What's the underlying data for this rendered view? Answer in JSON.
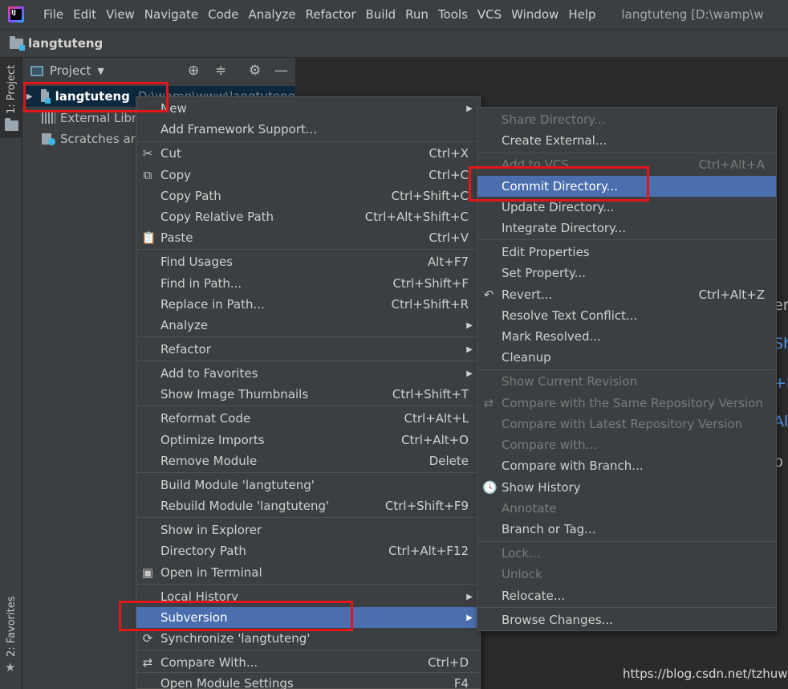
{
  "menubar": {
    "items": [
      "File",
      "Edit",
      "View",
      "Navigate",
      "Code",
      "Analyze",
      "Refactor",
      "Build",
      "Run",
      "Tools",
      "VCS",
      "Window",
      "Help"
    ],
    "window_title": "langtuteng [D:\\wamp\\w"
  },
  "navbar": {
    "project_name": "langtuteng"
  },
  "left_stripe": {
    "project_tab": "1: Project",
    "favorites_tab": "2: Favorites"
  },
  "project_panel": {
    "title": "Project",
    "root": {
      "name": "langtuteng",
      "path": "D:\\wamp\\www\\langtuteng"
    },
    "external_libraries": "External Libra",
    "scratches": "Scratches and"
  },
  "editor_fragments": [
    "ere",
    "Sh",
    "+I",
    "Al",
    "p"
  ],
  "main_menu": {
    "items": [
      {
        "label": "New",
        "submenu": true
      },
      {
        "label": "Add Framework Support..."
      },
      {
        "label": "Cut",
        "shortcut": "Ctrl+X",
        "icon": "✂"
      },
      {
        "label": "Copy",
        "shortcut": "Ctrl+C",
        "icon": "⧉"
      },
      {
        "label": "Copy Path",
        "shortcut": "Ctrl+Shift+C"
      },
      {
        "label": "Copy Relative Path",
        "shortcut": "Ctrl+Alt+Shift+C"
      },
      {
        "label": "Paste",
        "shortcut": "Ctrl+V",
        "icon": "📋"
      },
      {
        "label": "Find Usages",
        "shortcut": "Alt+F7"
      },
      {
        "label": "Find in Path...",
        "shortcut": "Ctrl+Shift+F"
      },
      {
        "label": "Replace in Path...",
        "shortcut": "Ctrl+Shift+R"
      },
      {
        "label": "Analyze",
        "submenu": true
      },
      {
        "label": "Refactor",
        "submenu": true
      },
      {
        "label": "Add to Favorites",
        "submenu": true
      },
      {
        "label": "Show Image Thumbnails",
        "shortcut": "Ctrl+Shift+T"
      },
      {
        "label": "Reformat Code",
        "shortcut": "Ctrl+Alt+L"
      },
      {
        "label": "Optimize Imports",
        "shortcut": "Ctrl+Alt+O"
      },
      {
        "label": "Remove Module",
        "shortcut": "Delete"
      },
      {
        "label": "Build Module 'langtuteng'"
      },
      {
        "label": "Rebuild Module 'langtuteng'",
        "shortcut": "Ctrl+Shift+F9"
      },
      {
        "label": "Show in Explorer"
      },
      {
        "label": "Directory Path",
        "shortcut": "Ctrl+Alt+F12"
      },
      {
        "label": "Open in Terminal",
        "icon": "▣"
      },
      {
        "label": "Local History",
        "submenu": true
      },
      {
        "label": "Subversion",
        "submenu": true,
        "selected": true
      },
      {
        "label": "Synchronize 'langtuteng'",
        "icon": "⟳"
      },
      {
        "label": "Compare With...",
        "shortcut": "Ctrl+D",
        "icon": "⇄"
      },
      {
        "label": "Open Module Settings",
        "shortcut": "F4"
      }
    ]
  },
  "svn_menu": {
    "items": [
      {
        "label": "Share Directory...",
        "disabled": true
      },
      {
        "label": "Create External..."
      },
      {
        "label": "Add to VCS",
        "shortcut": "Ctrl+Alt+A",
        "disabled": true
      },
      {
        "label": "Commit Directory...",
        "selected": true
      },
      {
        "label": "Update Directory..."
      },
      {
        "label": "Integrate Directory..."
      },
      {
        "label": "Edit Properties"
      },
      {
        "label": "Set Property..."
      },
      {
        "label": "Revert...",
        "shortcut": "Ctrl+Alt+Z",
        "icon": "↶"
      },
      {
        "label": "Resolve Text Conflict..."
      },
      {
        "label": "Mark Resolved..."
      },
      {
        "label": "Cleanup"
      },
      {
        "label": "Show Current Revision",
        "disabled": true
      },
      {
        "label": "Compare with the Same Repository Version",
        "disabled": true,
        "icon": "⇄"
      },
      {
        "label": "Compare with Latest Repository Version",
        "disabled": true
      },
      {
        "label": "Compare with...",
        "disabled": true
      },
      {
        "label": "Compare with Branch..."
      },
      {
        "label": "Show History",
        "icon": "🕓"
      },
      {
        "label": "Annotate",
        "disabled": true
      },
      {
        "label": "Branch or Tag..."
      },
      {
        "label": "Lock...",
        "disabled": true
      },
      {
        "label": "Unlock",
        "disabled": true
      },
      {
        "label": "Relocate..."
      },
      {
        "label": "Browse Changes..."
      }
    ]
  },
  "watermark": "https://blog.csdn.net/tzhuwb",
  "colors": {
    "selection": "#4b6eaf",
    "highlight_box": "#e0161b",
    "menu_bg": "#3c3f41"
  }
}
